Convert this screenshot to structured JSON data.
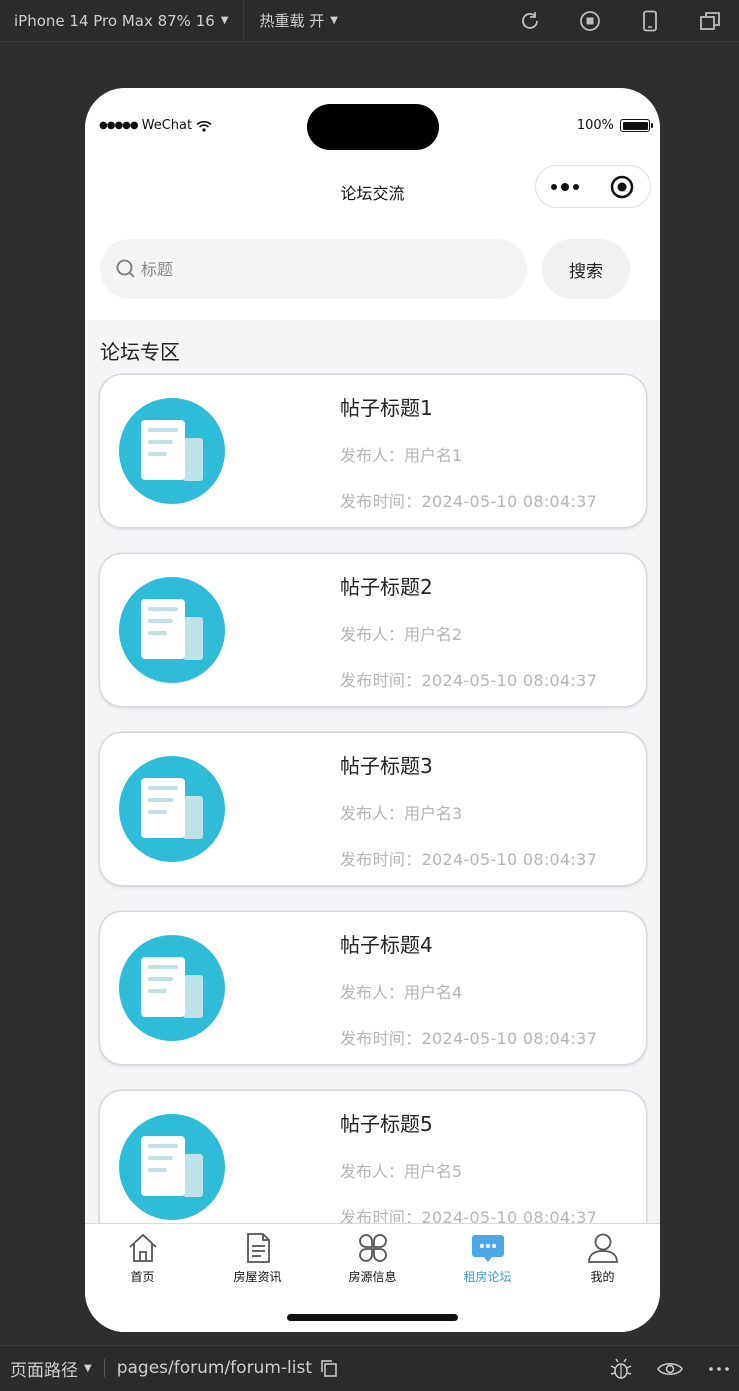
{
  "devtools": {
    "device_label": "iPhone 14 Pro Max 87% 16",
    "hot_reload_label": "热重载 开",
    "path_label": "页面路径",
    "path_value": "pages/forum/forum-list"
  },
  "status": {
    "carrier": "WeChat",
    "battery": "100%"
  },
  "nav": {
    "title": "论坛交流"
  },
  "search": {
    "placeholder": "标题",
    "button": "搜索"
  },
  "section_title": "论坛专区",
  "posts": [
    {
      "title": "帖子标题1",
      "author": "发布人：用户名1",
      "time": "发布时间：2024-05-10 08:04:37"
    },
    {
      "title": "帖子标题2",
      "author": "发布人：用户名2",
      "time": "发布时间：2024-05-10 08:04:37"
    },
    {
      "title": "帖子标题3",
      "author": "发布人：用户名3",
      "time": "发布时间：2024-05-10 08:04:37"
    },
    {
      "title": "帖子标题4",
      "author": "发布人：用户名4",
      "time": "发布时间：2024-05-10 08:04:37"
    },
    {
      "title": "帖子标题5",
      "author": "发布人：用户名5",
      "time": "发布时间：2024-05-10 08:04:37"
    }
  ],
  "tabs": [
    {
      "label": "首页",
      "icon": "home-icon"
    },
    {
      "label": "房屋资讯",
      "icon": "document-icon"
    },
    {
      "label": "房源信息",
      "icon": "grid-icon"
    },
    {
      "label": "租房论坛",
      "icon": "chat-icon",
      "active": true
    },
    {
      "label": "我的",
      "icon": "user-icon"
    }
  ],
  "colors": {
    "accent": "#3a9ed6",
    "post_icon": "#2fbcd8"
  }
}
